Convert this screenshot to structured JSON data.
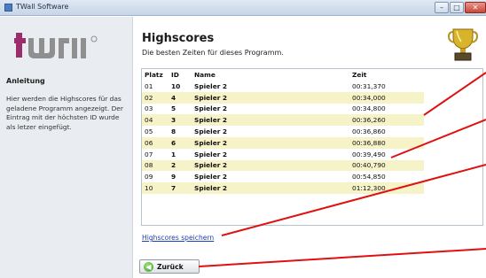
{
  "window": {
    "title": "TWall Software",
    "min_glyph": "–",
    "max_glyph": "□",
    "close_glyph": "✕"
  },
  "sidebar": {
    "logo_text": "twall",
    "heading": "Anleitung",
    "text": "Hier werden die Highscores für das geladene Programm angezeigt. Der Eintrag mit der höchsten ID wurde als letzer eingefügt."
  },
  "main": {
    "title": "Highscores",
    "subtitle": "Die besten Zeiten für dieses Programm.",
    "trophy_icon": "trophy-icon"
  },
  "table": {
    "headers": [
      "Platz",
      "ID",
      "Name",
      "Zeit"
    ],
    "rows": [
      [
        "01",
        "10",
        "Spieler 2",
        "00:31,370"
      ],
      [
        "02",
        "4",
        "Spieler 2",
        "00:34,000"
      ],
      [
        "03",
        "5",
        "Spieler 2",
        "00:34,800"
      ],
      [
        "04",
        "3",
        "Spieler 2",
        "00:36,260"
      ],
      [
        "05",
        "8",
        "Spieler 2",
        "00:36,860"
      ],
      [
        "06",
        "6",
        "Spieler 2",
        "00:36,880"
      ],
      [
        "07",
        "1",
        "Spieler 2",
        "00:39,490"
      ],
      [
        "08",
        "2",
        "Spieler 2",
        "00:40,790"
      ],
      [
        "09",
        "9",
        "Spieler 2",
        "00:54,850"
      ],
      [
        "10",
        "7",
        "Spieler 2",
        "01:12,300"
      ]
    ]
  },
  "actions": {
    "save_link": "Highscores speichern",
    "back_label": "Zurück",
    "back_icon": "back-arrow-icon"
  },
  "colors": {
    "row_alt": "#f6f3c9",
    "link": "#1a3fb4",
    "annotation_lines": "#e01010"
  }
}
